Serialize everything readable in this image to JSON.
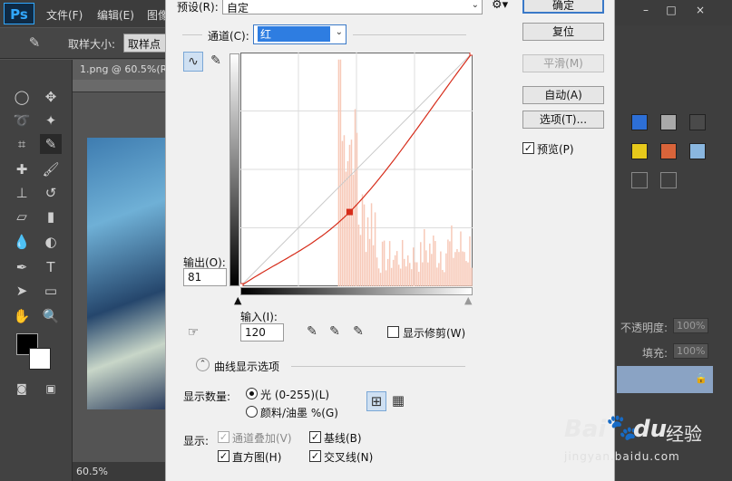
{
  "app": {
    "logo": "Ps",
    "menu": [
      "文件(F)",
      "编辑(E)",
      "图像"
    ],
    "options_bar": {
      "sample_size_label": "取样大小:",
      "sample_size_value": "取样点"
    },
    "document_tab": "1.png @ 60.5%(R",
    "zoom": "60.5%",
    "window_buttons": [
      "–",
      "□",
      "×"
    ]
  },
  "right_panel": {
    "opacity_label": "不透明度:",
    "opacity_value": "100%",
    "fill_label": "填充:",
    "fill_value": "100%"
  },
  "dialog": {
    "preset_label": "预设(R):",
    "preset_value": "自定",
    "channel_label": "通道(C):",
    "channel_value": "红",
    "output_label": "输出(O):",
    "output_value": "81",
    "input_label": "输入(I):",
    "input_value": "120",
    "show_clipping_label": "显示修剪(W)",
    "buttons": {
      "ok": "确定",
      "reset": "复位",
      "smooth": "平滑(M)",
      "auto": "自动(A)",
      "options": "选项(T)..."
    },
    "preview_label": "预览(P)",
    "curve_display_options_label": "曲线显示选项",
    "show_amount_label": "显示数量:",
    "light_label": "光 (0-255)(L)",
    "pigment_label": "颜料/油墨 %(G)",
    "show_label": "显示:",
    "channel_overlays_label": "通道叠加(V)",
    "baseline_label": "基线(B)",
    "histogram_label": "直方图(H)",
    "intersection_label": "交叉线(N)",
    "checks": {
      "preview": true,
      "show_clipping": false,
      "channel_overlays": true,
      "baseline": true,
      "histogram": true,
      "intersection": true
    },
    "show_amount": "light"
  },
  "curve": {
    "points": [
      [
        0,
        0
      ],
      [
        120,
        81
      ],
      [
        255,
        255
      ]
    ],
    "selected_point": [
      120,
      81
    ],
    "colors": {
      "curve": "#d62c1a",
      "histogram": "#f7c9b8",
      "grid": "#dcdcdc"
    }
  },
  "watermark": {
    "brand": "Bai",
    "brand2": "du",
    "suffix": "经验",
    "url": "jingyan.baidu.com"
  }
}
